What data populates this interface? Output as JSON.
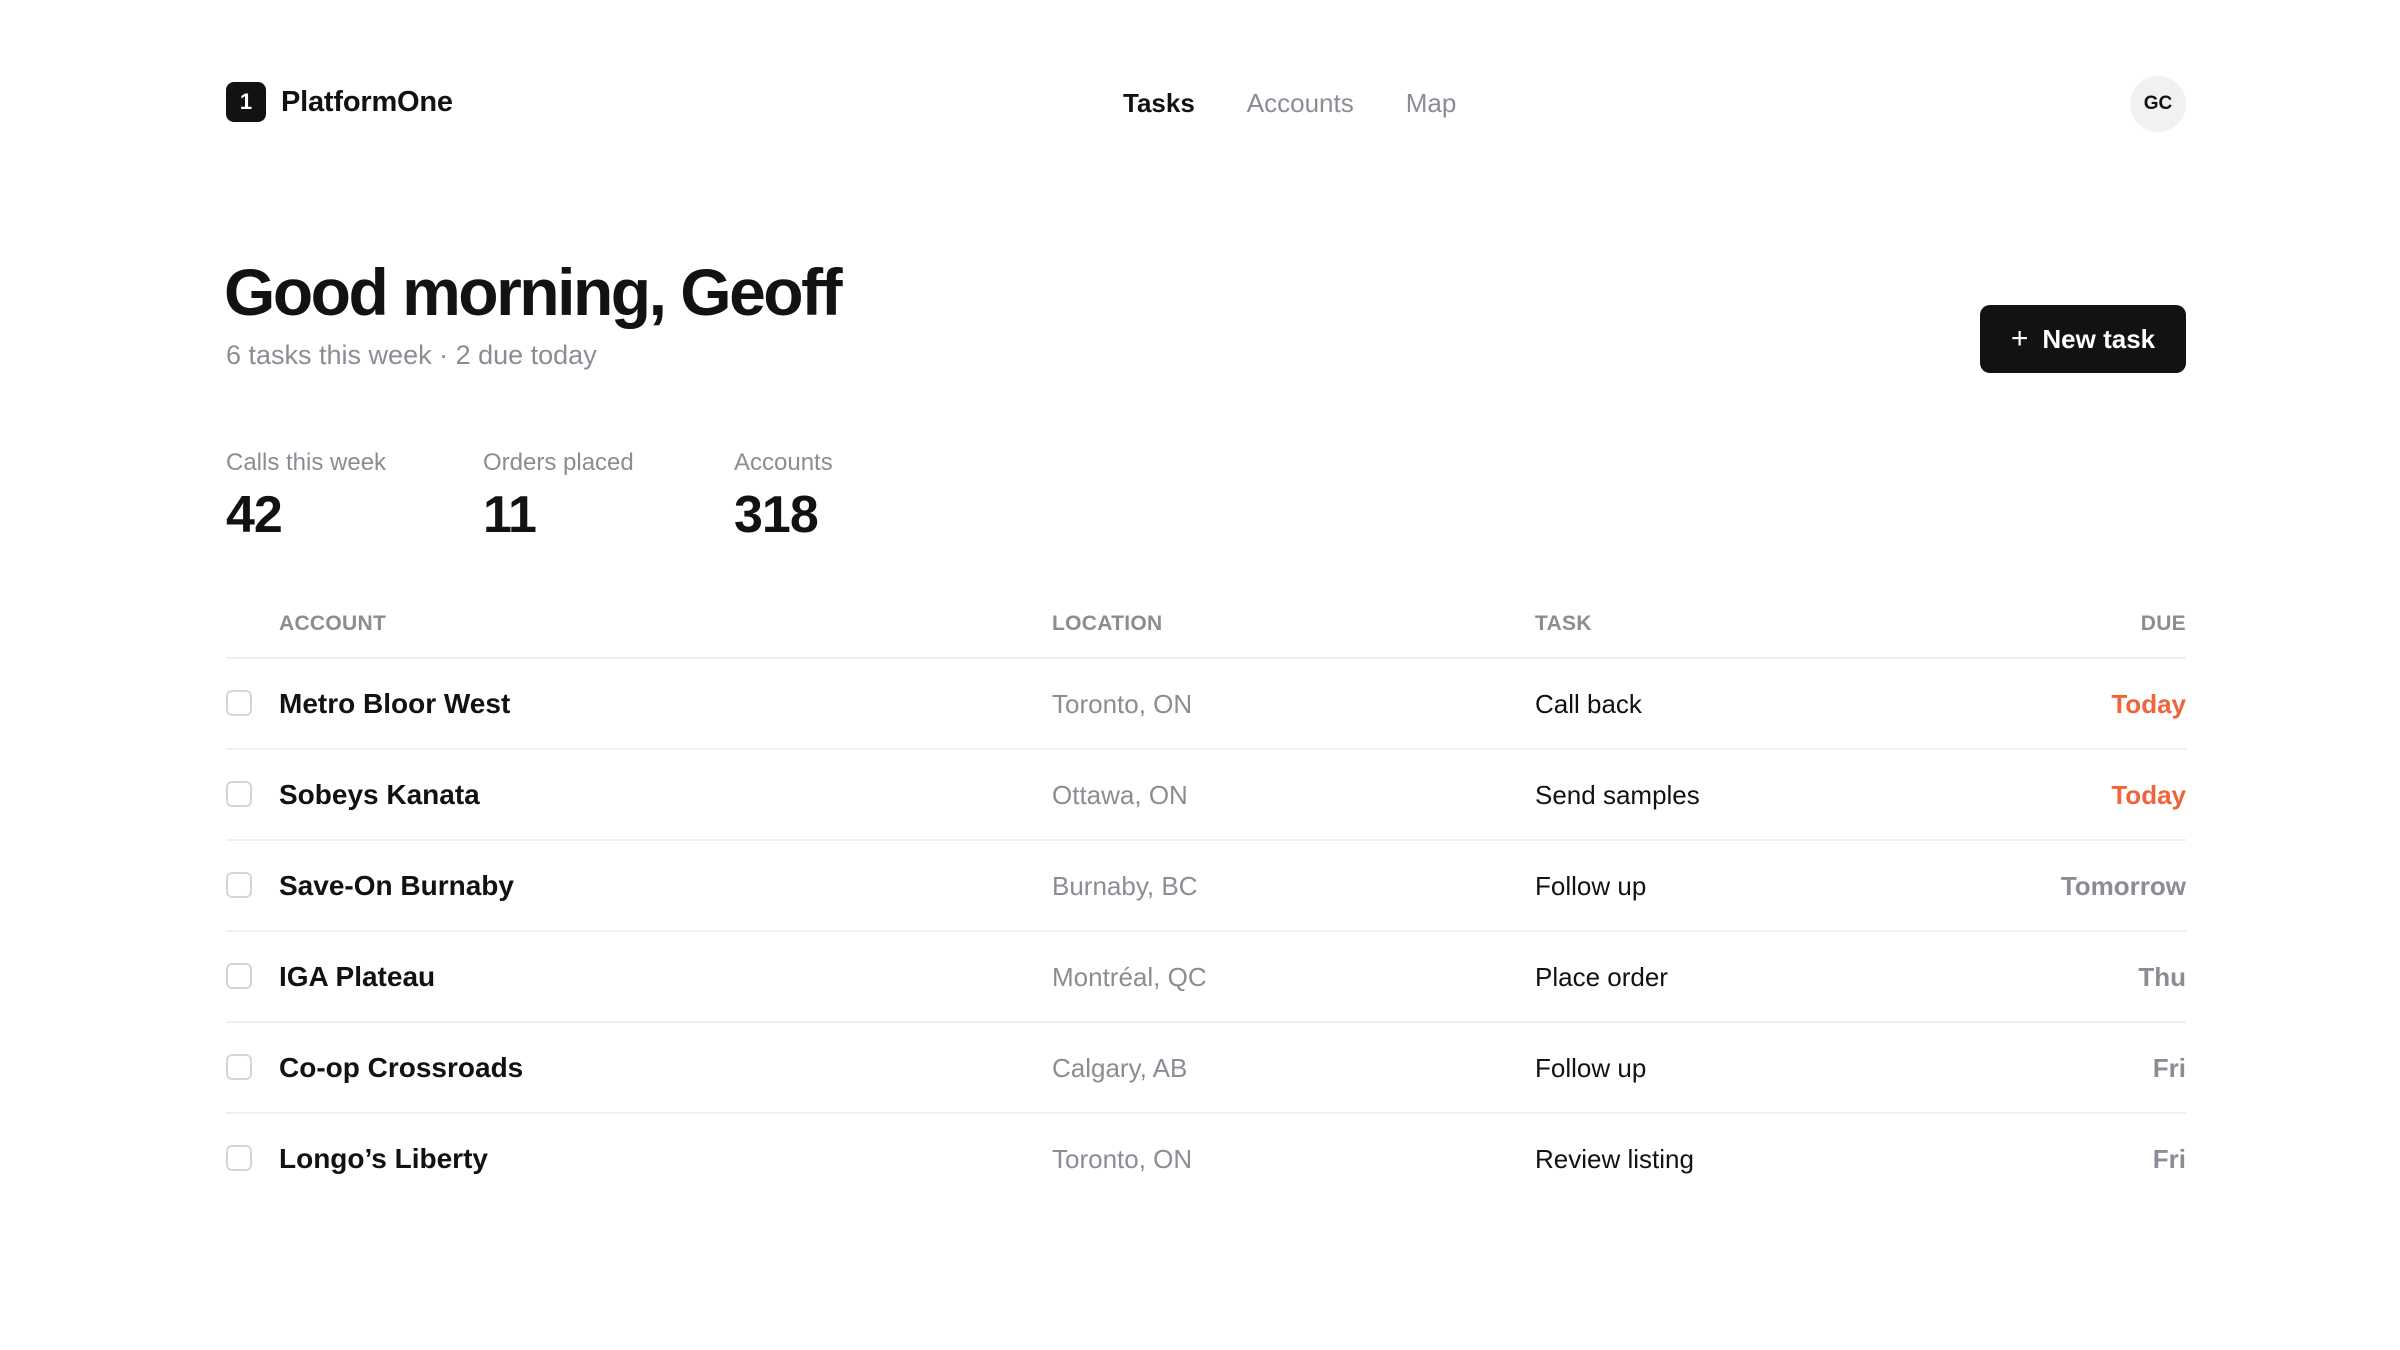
{
  "brand": {
    "mark": "1",
    "name": "PlatformOne"
  },
  "nav": [
    {
      "label": "Tasks",
      "active": true
    },
    {
      "label": "Accounts",
      "active": false
    },
    {
      "label": "Map",
      "active": false
    }
  ],
  "user": {
    "initials": "GC"
  },
  "header": {
    "greeting": "Good morning, Geoff",
    "subline": "6 tasks this week · 2 due today",
    "new_task_label": "New task"
  },
  "stats": [
    {
      "label": "Calls this week",
      "value": "42"
    },
    {
      "label": "Orders placed",
      "value": "11"
    },
    {
      "label": "Accounts",
      "value": "318"
    }
  ],
  "table": {
    "columns": [
      "ACCOUNT",
      "LOCATION",
      "TASK",
      "DUE"
    ],
    "rows": [
      {
        "account": "Metro Bloor West",
        "location": "Toronto, ON",
        "task": "Call back",
        "due": "Today",
        "due_color": "#f0643c"
      },
      {
        "account": "Sobeys Kanata",
        "location": "Ottawa, ON",
        "task": "Send samples",
        "due": "Today",
        "due_color": "#f0643c"
      },
      {
        "account": "Save-On Burnaby",
        "location": "Burnaby, BC",
        "task": "Follow up",
        "due": "Tomorrow",
        "due_color": "#8a8d93"
      },
      {
        "account": "IGA Plateau",
        "location": "Montréal, QC",
        "task": "Place order",
        "due": "Thu",
        "due_color": "#8a8d93"
      },
      {
        "account": "Co-op Crossroads",
        "location": "Calgary, AB",
        "task": "Follow up",
        "due": "Fri",
        "due_color": "#8a8d93"
      },
      {
        "account": "Longo’s Liberty",
        "location": "Toronto, ON",
        "task": "Review listing",
        "due": "Fri",
        "due_color": "#8a8d93"
      }
    ]
  }
}
